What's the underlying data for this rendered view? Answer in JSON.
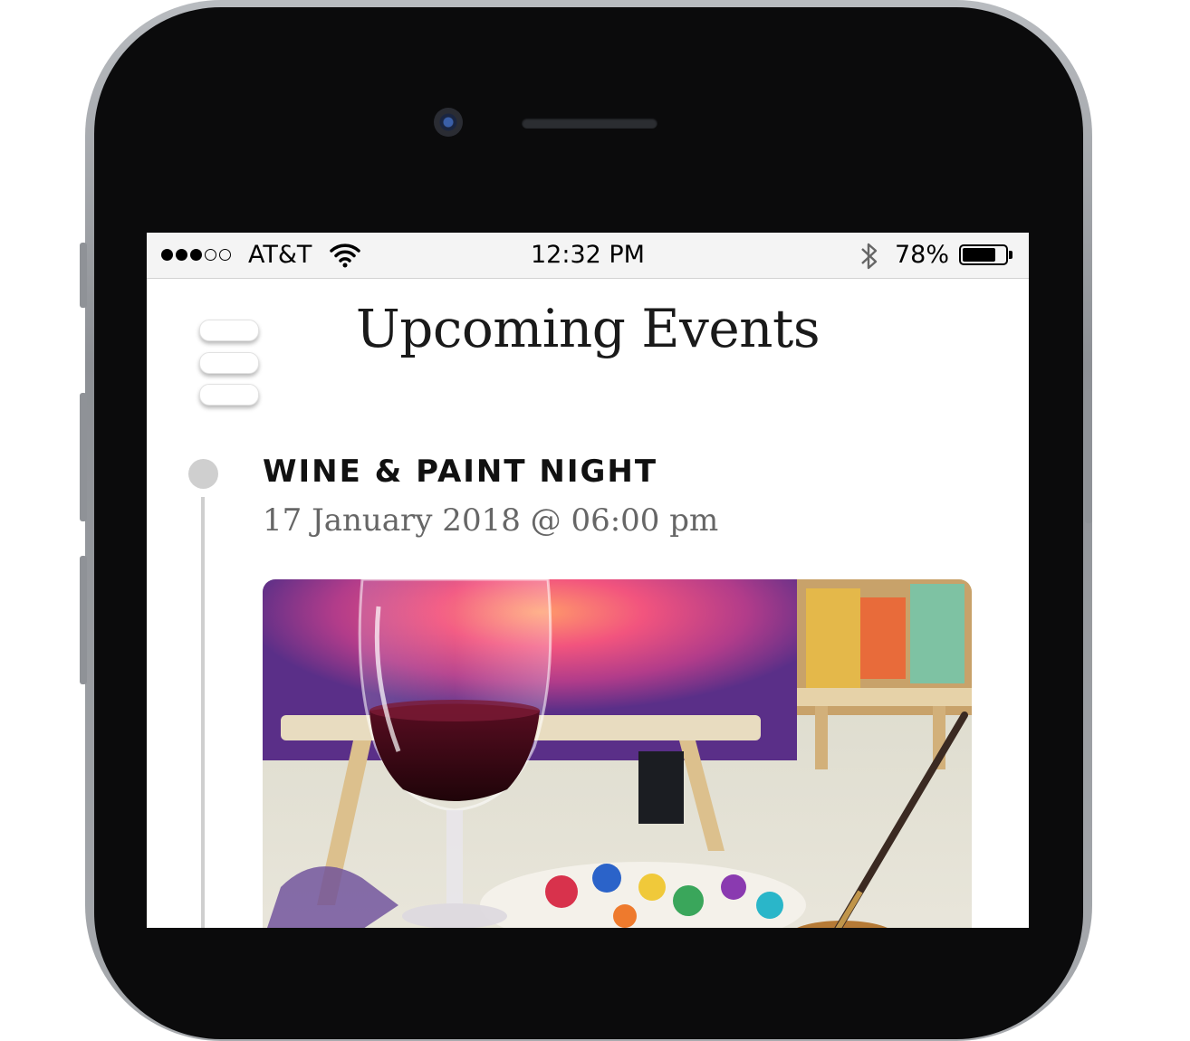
{
  "status_bar": {
    "signal_filled": 3,
    "signal_total": 5,
    "carrier": "AT&T",
    "time": "12:32 PM",
    "battery_percent_text": "78%",
    "battery_level": 0.78,
    "icons": [
      "wifi-icon",
      "bluetooth-icon",
      "battery-icon"
    ]
  },
  "header": {
    "title": "Upcoming Events",
    "menu_icon": "hamburger-menu-icon"
  },
  "events": [
    {
      "title": "WINE & PAINT NIGHT",
      "date": "17 January 2018 @ 06:00 pm"
    }
  ],
  "colors": {
    "status_bar_bg": "#f4f4f4",
    "timeline": "#cfcfcf",
    "title_text": "#1a1a1a",
    "date_text": "#666666"
  }
}
